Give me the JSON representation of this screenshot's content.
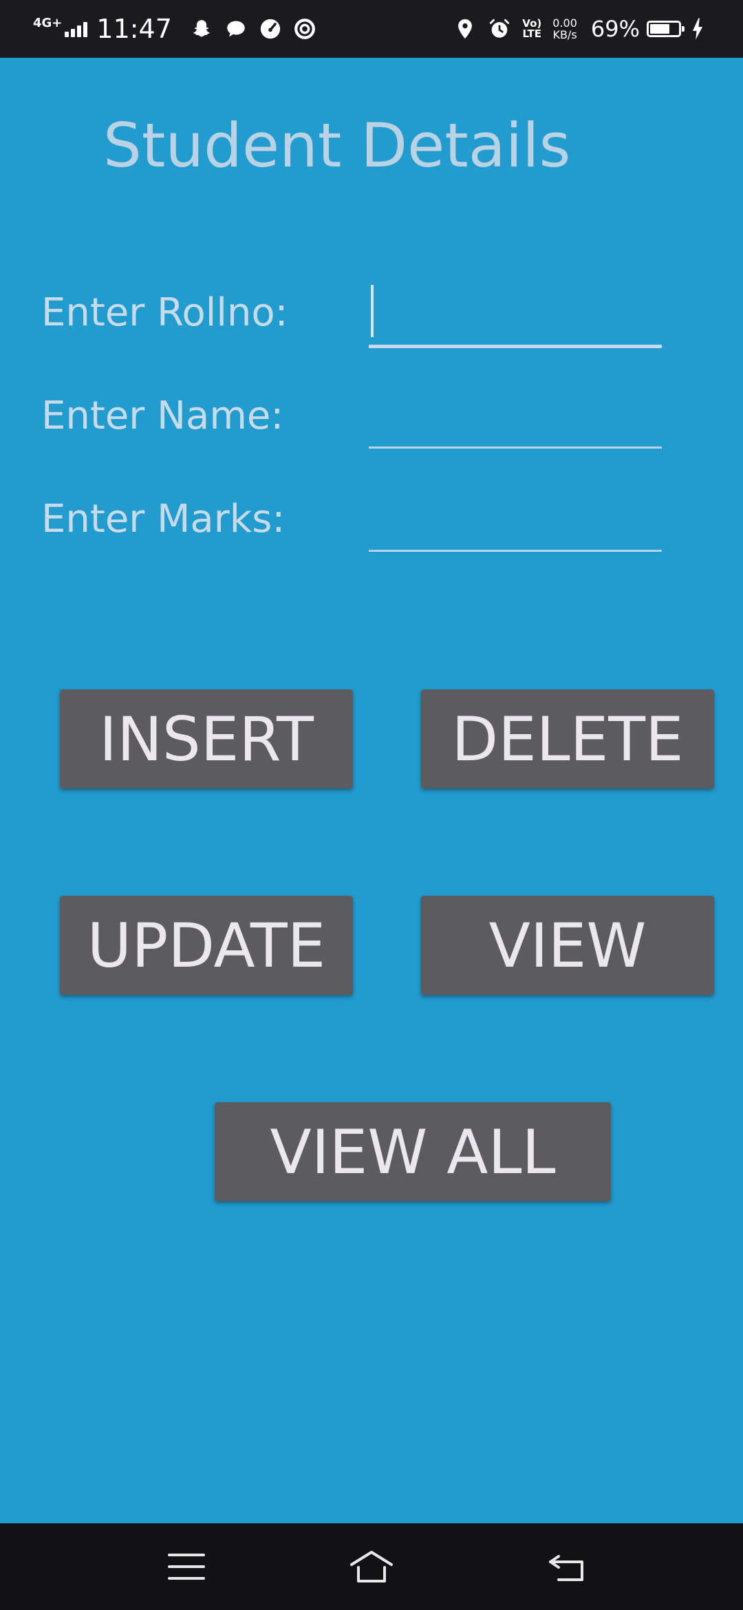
{
  "status_bar": {
    "network": "4G+",
    "time": "11:47",
    "volte": [
      "Vo)",
      "LTE"
    ],
    "speed": [
      "0.00",
      "KB/s"
    ],
    "battery_percent": "69%",
    "battery_level": 0.69,
    "icons": [
      "snapchat-icon",
      "message-icon",
      "speedometer-icon",
      "ring-icon",
      "location-icon",
      "alarm-icon",
      "charging-icon"
    ]
  },
  "page": {
    "title": "Student Details",
    "background": "#229bcf"
  },
  "form": {
    "rollno_label": "Enter Rollno:",
    "name_label": "Enter Name:",
    "marks_label": "Enter Marks:",
    "rollno_value": "",
    "name_value": "",
    "marks_value": ""
  },
  "buttons": {
    "insert": "INSERT",
    "delete": "DELETE",
    "update": "UPDATE",
    "view": "VIEW",
    "view_all": "VIEW ALL",
    "color": "#5c5c5f"
  },
  "nav_bar": {
    "icons": [
      "menu-icon",
      "home-icon",
      "back-icon"
    ]
  }
}
